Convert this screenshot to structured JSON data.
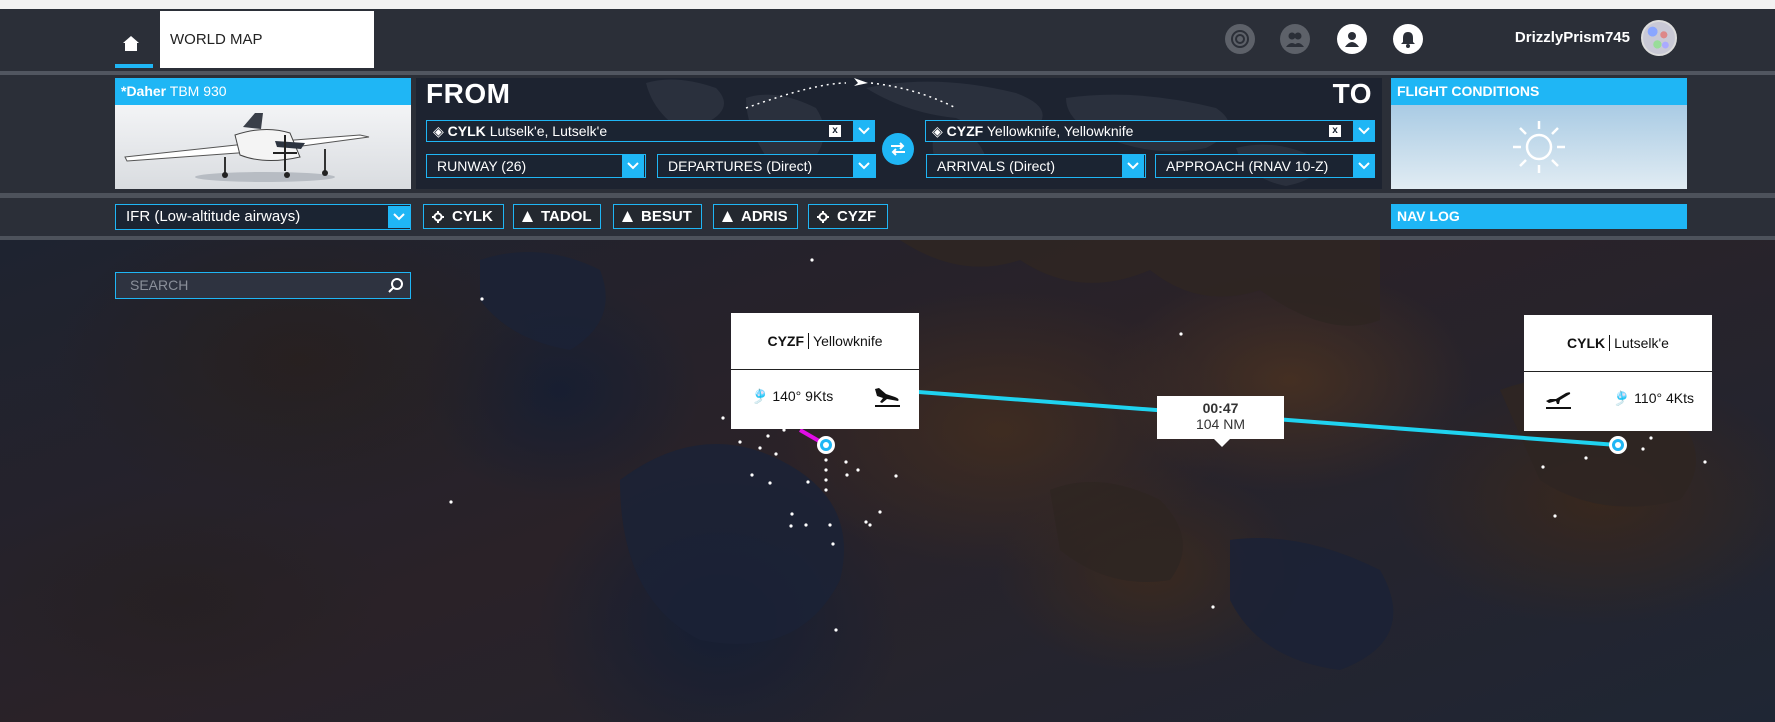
{
  "header": {
    "home_icon": "home-icon",
    "world_map_tab": "WORLD MAP",
    "icons": [
      "activity-icon",
      "friends-icon",
      "profile-icon",
      "notifications-icon"
    ],
    "username": "DrizzlyPrism745"
  },
  "aircraft": {
    "prefix": "*Daher",
    "model": "TBM 930"
  },
  "route": {
    "from_label": "FROM",
    "to_label": "TO",
    "departure": {
      "code": "CYLK",
      "name": "Lutselk'e, Lutselk'e"
    },
    "arrival": {
      "code": "CYZF",
      "name": "Yellowknife, Yellowknife"
    },
    "clear_label": "x",
    "runway": "RUNWAY (26)",
    "departures": "DEPARTURES (Direct)",
    "arrivals": "ARRIVALS (Direct)",
    "approach": "APPROACH (RNAV 10-Z)"
  },
  "conditions": {
    "title": "FLIGHT CONDITIONS",
    "icon": "sun-icon"
  },
  "flight_plan": {
    "type": "IFR (Low-altitude airways)",
    "waypoints": [
      {
        "label": "CYLK",
        "icon": "airport-icon"
      },
      {
        "label": "TADOL",
        "icon": "waypoint-triangle-icon"
      },
      {
        "label": "BESUT",
        "icon": "waypoint-triangle-icon"
      },
      {
        "label": "ADRIS",
        "icon": "waypoint-triangle-icon"
      },
      {
        "label": "CYZF",
        "icon": "airport-icon"
      }
    ],
    "nav_log": "NAV LOG"
  },
  "map": {
    "search_placeholder": "SEARCH",
    "arrival_popup": {
      "code": "CYZF",
      "name": "Yellowknife",
      "wind": "140° 9Kts"
    },
    "departure_popup": {
      "code": "CYLK",
      "name": "Lutselk'e",
      "wind": "110° 4Kts"
    },
    "leg_time": "00:47",
    "leg_distance": "104 NM",
    "route_color": "#1fd3f0",
    "accent": "#1fb6f5"
  }
}
